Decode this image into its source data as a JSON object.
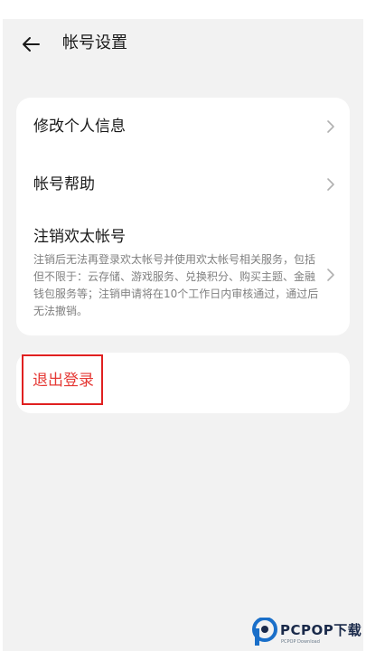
{
  "header": {
    "back_icon": "arrow-left-icon",
    "title": "帐号设置"
  },
  "settings": {
    "items": [
      {
        "label": "修改个人信息",
        "icon": "chevron-right-icon"
      },
      {
        "label": "帐号帮助",
        "icon": "chevron-right-icon"
      },
      {
        "label": "注销欢太帐号",
        "description": "注销后无法再登录欢太帐号并使用欢太帐号相关服务，包括但不限于：云存储、游戏服务、兑换积分、购买主题、金融钱包服务等；注销申请将在10个工作日内审核通过，通过后无法撤销。",
        "icon": "chevron-right-icon"
      }
    ]
  },
  "logout": {
    "label": "退出登录",
    "color": "#e53935"
  },
  "watermark": {
    "brand": "PCPOP下载",
    "sub": "PCPOP Download"
  },
  "colors": {
    "background": "#f2f2f2",
    "card": "#ffffff",
    "text_primary": "#1a1a1a",
    "text_secondary": "#808080",
    "highlight_border": "#e02020"
  }
}
